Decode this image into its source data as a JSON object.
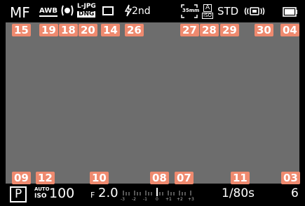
{
  "top": {
    "focus_mode": "MF",
    "white_balance": "AWB",
    "file_format_top": "L-JPG",
    "file_format_bottom": "DNG",
    "flash_mode": "2nd",
    "crop": "35mm",
    "film_style": "STD",
    "iso_bracket_top": "A",
    "iso_bracket_bottom": "ISO"
  },
  "bottom": {
    "exposure_mode": "P",
    "iso_label": "ISO",
    "iso_auto": "AUTO",
    "iso_value": "100",
    "aperture_prefix": "F",
    "aperture_value": "2.0",
    "scale_labels": [
      "-3",
      "-2",
      "-1",
      "0",
      "+1",
      "+2",
      "+3"
    ],
    "shutter": "1/80s",
    "shots_remaining": "6"
  },
  "badges": {
    "b15": "15",
    "b19": "19",
    "b18": "18",
    "b20": "20",
    "b14": "14",
    "b26": "26",
    "b27": "27",
    "b28": "28",
    "b29": "29",
    "b30": "30",
    "b04": "04",
    "b09": "09",
    "b12": "12",
    "b10": "10",
    "b08": "08",
    "b07": "07",
    "b11": "11",
    "b03": "03"
  },
  "colors": {
    "badge": "#ef8a6f",
    "view": "#6d6d6d"
  }
}
